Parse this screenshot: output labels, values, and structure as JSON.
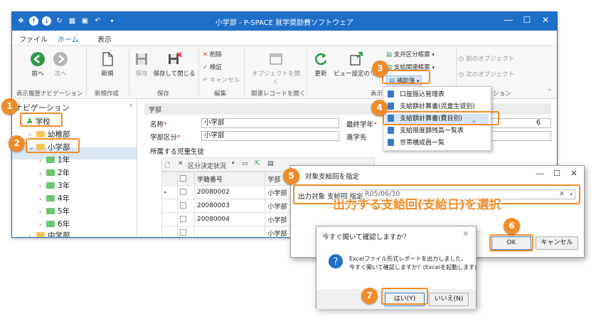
{
  "window": {
    "title": "小学部 - P-SPACE 就学奨励費ソフトウェア",
    "controls": [
      "―",
      "☐",
      "✕"
    ]
  },
  "menu": {
    "tabs": [
      "ファイル",
      "ホーム",
      "表示"
    ]
  },
  "ribbon": {
    "nav_back": "前へ",
    "nav_next": "次へ",
    "group_nav_history": "表示履歴ナビゲーション",
    "new": "新規",
    "group_new": "新規作成",
    "save": "保存",
    "save_close": "保存して閉じる",
    "group_save": "保存",
    "delete": "削除",
    "verify": "検証",
    "cancel": "キャンセル",
    "group_edit": "編集",
    "open_object": "オブジェクトを開く",
    "group_related": "関連レコードを開く",
    "refresh": "更新",
    "view_settings": "ビュー設定のリセット",
    "group_view": "表示",
    "report_category": "支弁区分帳票",
    "report_payment": "支給関連帳票",
    "report_aux": "補助簿",
    "prev_object": "前のオブジェクト",
    "next_object": "次のオブジェクト",
    "group_object": "ション"
  },
  "navigation": {
    "title": "ナビゲーション",
    "items": [
      {
        "label": "学校",
        "arrow": "⌄"
      },
      {
        "label": "幼稚部",
        "arrow": "›"
      },
      {
        "label": "小学部",
        "arrow": "⌄"
      },
      {
        "label": "1年",
        "arrow": "›"
      },
      {
        "label": "2年",
        "arrow": "›"
      },
      {
        "label": "3年",
        "arrow": "›"
      },
      {
        "label": "4年",
        "arrow": "›"
      },
      {
        "label": "5年",
        "arrow": "›"
      },
      {
        "label": "6年",
        "arrow": "›"
      },
      {
        "label": "中学部",
        "arrow": "›"
      }
    ]
  },
  "detail": {
    "section": "学部",
    "name_label": "名称",
    "name_value": "小学部",
    "category_label": "学部区分",
    "category_value": "小学部",
    "max_grade_label": "最終学年",
    "max_grade_value": "6",
    "next_label": "進学先",
    "students_label": "所属する児童生徒",
    "toolbar_status": "区分決定状況"
  },
  "grid": {
    "headers": [
      "学籍番号",
      "学部"
    ],
    "rows": [
      [
        "20080002",
        "小学部"
      ],
      [
        "20080003",
        "小学部"
      ],
      [
        "20080004",
        "小学部"
      ],
      [
        "",
        "小学部"
      ]
    ]
  },
  "dropdown": {
    "items": [
      "口座振込管理表",
      "支給額計算書(児童生徒別)",
      "支給額計算書(費目別)",
      "支給限度額残高一覧表",
      "世帯構成員一覧"
    ]
  },
  "dialog1": {
    "title": "対象支給回を指定",
    "field_label": "出力対象 支給回 指定",
    "field_value": "R05/06/30",
    "ok": "OK",
    "cancel": "キャンセル"
  },
  "dialog2": {
    "title": "今すぐ開いて確認しますか？",
    "message_1": "Excelファイル形式レポートを出力しました。",
    "message_2": "今すぐ開いて確認しますか？(Excelを起動します)",
    "yes": "はい(Y)",
    "no": "いいえ(N)"
  },
  "annotation": {
    "text": "出力する支給回(支給日)を選択"
  },
  "callouts": [
    "1",
    "2",
    "3",
    "4",
    "5",
    "6",
    "7"
  ],
  "colors": {
    "accent": "#1e6fc8",
    "callout": "#f08c28",
    "selection": "#dbe7f5"
  }
}
